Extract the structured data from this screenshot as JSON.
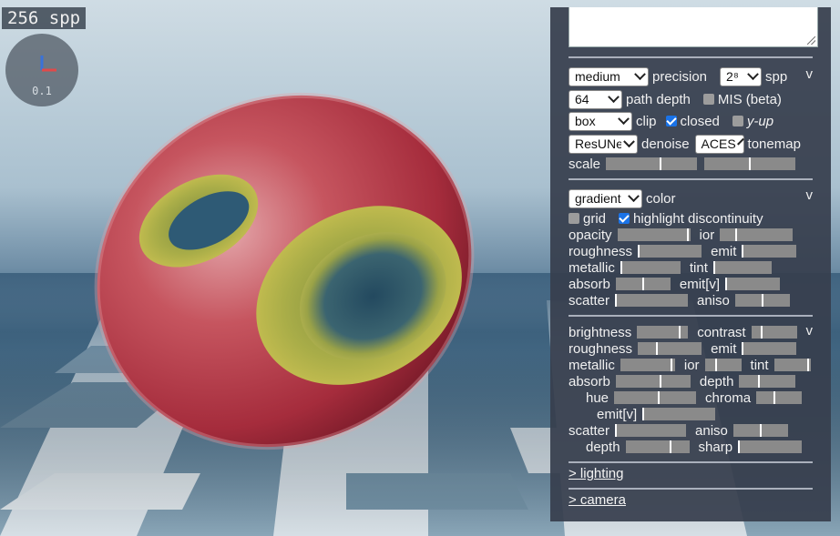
{
  "viewport": {
    "spp_counter": "256 spp",
    "axis_gizmo_scale": "0.1"
  },
  "render_section": {
    "precision_select": "medium",
    "precision_label": "precision",
    "spp_select": "2⁸",
    "spp_label": "spp",
    "collapse_toggle": "v",
    "path_depth_select": "64",
    "path_depth_label": "path depth",
    "mis_label": "MIS (beta)",
    "mis_checked": false,
    "clip_select": "box",
    "clip_label": "clip",
    "closed_label": "closed",
    "closed_checked": true,
    "yup_label": "y-up",
    "yup_checked": false,
    "denoise_select": "ResUNet",
    "denoise_label": "denoise",
    "tonemap_select": "ACES",
    "tonemap_label": "tonemap",
    "scale_label": "scale",
    "scale_values": [
      0.6,
      0.5
    ]
  },
  "material_section": {
    "color_select": "gradient",
    "color_label": "color",
    "collapse_toggle": "v",
    "grid_label": "grid",
    "grid_checked": false,
    "highlight_label": "highlight discontinuity",
    "highlight_checked": true,
    "sliders": [
      {
        "label": "opacity",
        "value": 0.97
      },
      {
        "label": "ior",
        "value": 0.22
      },
      {
        "label": "roughness",
        "value": 0.0
      },
      {
        "label": "emit",
        "value": 0.0
      },
      {
        "label": "metallic",
        "value": 0.0
      },
      {
        "label": "tint",
        "value": 0.0
      },
      {
        "label": "absorb",
        "value": 0.5
      },
      {
        "label": "emit[v]",
        "value": 0.0
      },
      {
        "label": "scatter",
        "value": 0.0
      },
      {
        "label": "aniso",
        "value": 0.5
      }
    ]
  },
  "surface_section": {
    "collapse_toggle": "v",
    "sliders": [
      {
        "label": "brightness",
        "value": 0.85
      },
      {
        "label": "contrast",
        "value": 0.2
      },
      {
        "label": "roughness",
        "value": 0.3
      },
      {
        "label": "emit",
        "value": 0.0
      },
      {
        "label": "metallic",
        "value": 0.95
      },
      {
        "label": "ior",
        "value": 0.3
      },
      {
        "label": "tint",
        "value": 0.95
      },
      {
        "label": "absorb",
        "value": 0.6
      },
      {
        "label": "depth",
        "value": 0.35
      },
      {
        "label": "hue",
        "value": 0.55
      },
      {
        "label": "chroma",
        "value": 0.4
      },
      {
        "label": "emit[v]",
        "value": 0.0
      },
      {
        "label": "scatter",
        "value": 0.0
      },
      {
        "label": "aniso",
        "value": 0.5
      },
      {
        "label": "depth",
        "value": 0.7
      },
      {
        "label": "sharp",
        "value": 0.0
      }
    ]
  },
  "links": {
    "lighting": "> lighting",
    "camera": "> camera"
  }
}
